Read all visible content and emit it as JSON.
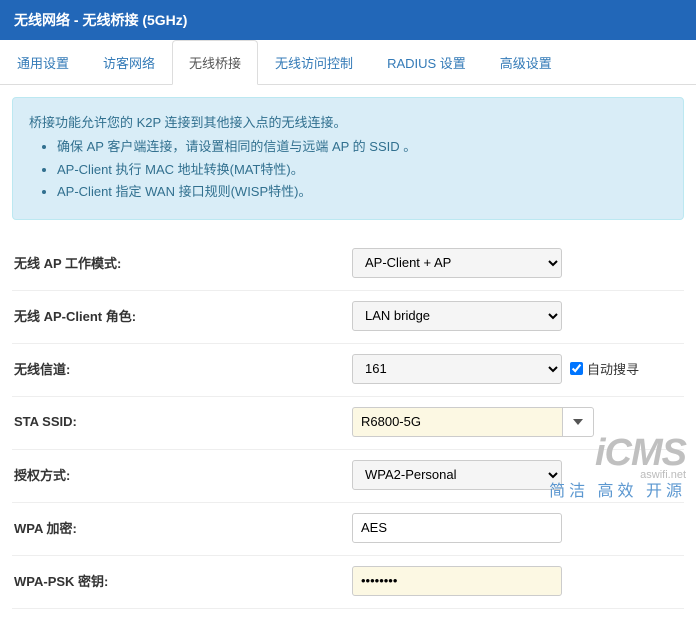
{
  "header": {
    "title": "无线网络 - 无线桥接 (5GHz)"
  },
  "tabs": [
    {
      "label": "通用设置"
    },
    {
      "label": "访客网络"
    },
    {
      "label": "无线桥接"
    },
    {
      "label": "无线访问控制"
    },
    {
      "label": "RADIUS 设置"
    },
    {
      "label": "高级设置"
    }
  ],
  "info": {
    "intro": "桥接功能允许您的 K2P 连接到其他接入点的无线连接。",
    "items": [
      "确保 AP 客户端连接，请设置相同的信道与远端 AP 的 SSID 。",
      "AP-Client 执行 MAC 地址转换(MAT特性)。",
      "AP-Client 指定 WAN 接口规则(WISP特性)。"
    ]
  },
  "form": {
    "ap_mode": {
      "label": "无线 AP 工作模式:",
      "value": "AP-Client + AP"
    },
    "client_role": {
      "label": "无线 AP-Client 角色:",
      "value": "LAN bridge"
    },
    "channel": {
      "label": "无线信道:",
      "value": "161",
      "auto_label": "自动搜寻",
      "auto_checked": true
    },
    "sta_ssid": {
      "label": "STA SSID:",
      "value": "R6800-5G"
    },
    "auth": {
      "label": "授权方式:",
      "value": "WPA2-Personal"
    },
    "wpa_enc": {
      "label": "WPA 加密:",
      "value": "AES"
    },
    "wpa_psk": {
      "label": "WPA-PSK 密钥:",
      "value": "••••••••"
    }
  },
  "watermark": {
    "big": "iCMS",
    "small": "aswifi.net",
    "sub": "简洁 高效 开源"
  }
}
